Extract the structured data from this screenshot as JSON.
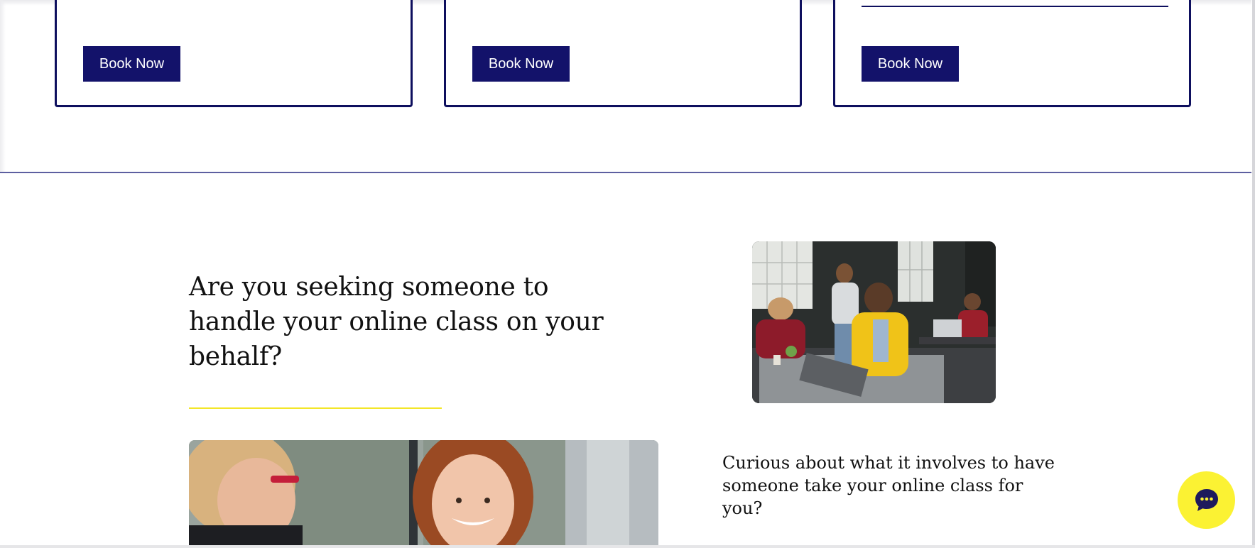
{
  "cards": [
    {
      "button_label": "Book Now"
    },
    {
      "button_label": "Book Now"
    },
    {
      "button_label": "Book Now"
    }
  ],
  "section": {
    "heading": "Are you seeking someone to handle your online class on your behalf?",
    "subheading": "Curious about what it involves to have someone take your online class for you?"
  },
  "images": {
    "classroom": "photo-students-classroom",
    "tutor": "photo-tutor-student"
  },
  "chat": {
    "icon": "chat-bubble-icon"
  },
  "colors": {
    "primary_navy": "#13126a",
    "accent_yellow": "#fbf233",
    "rule_yellow": "#f3e629",
    "divider_blue": "#5d5fa0"
  }
}
